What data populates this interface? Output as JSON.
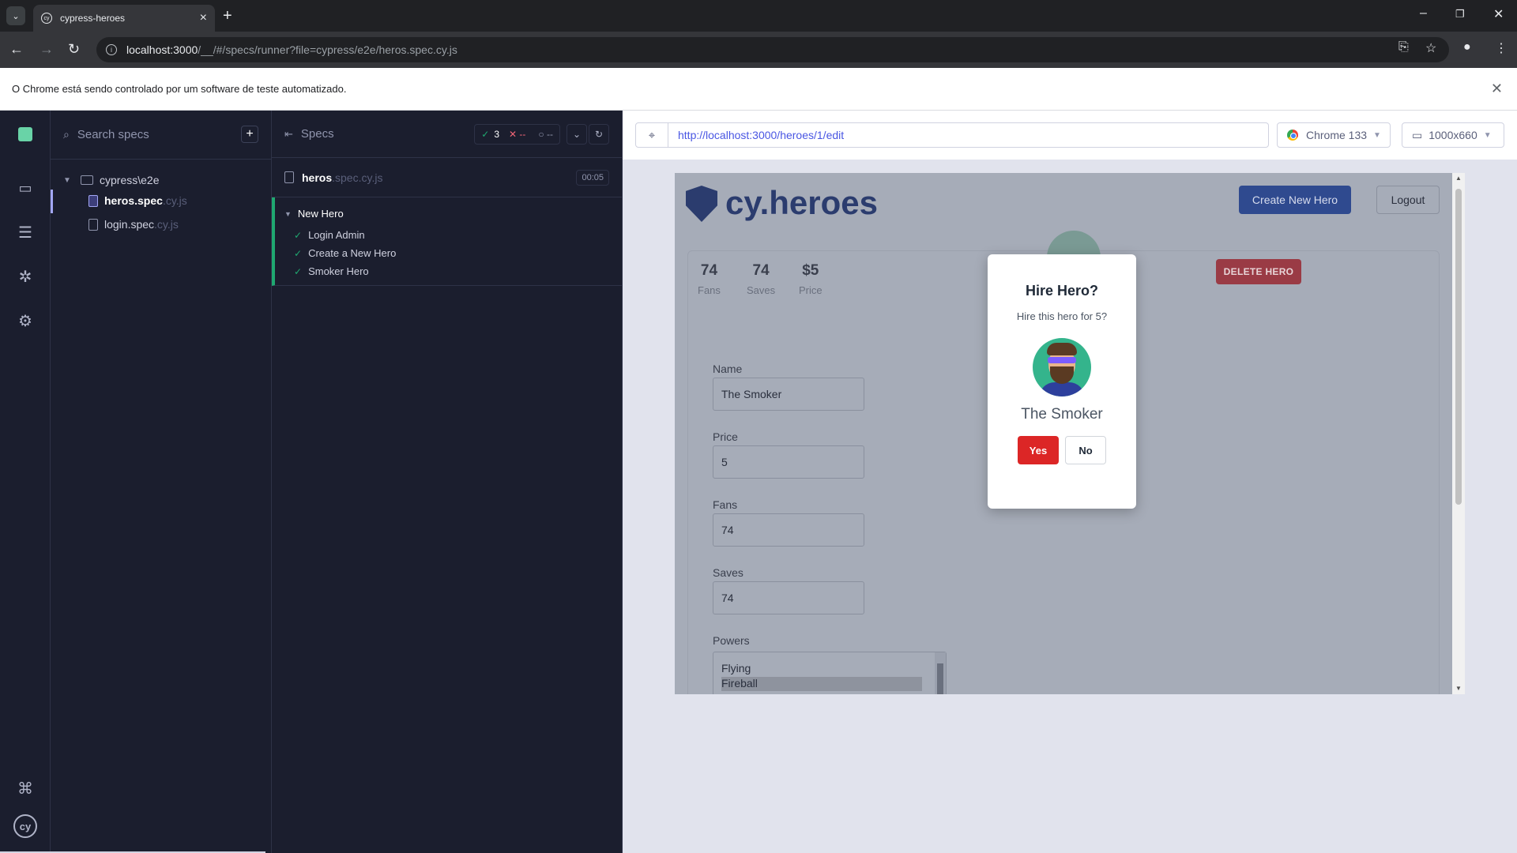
{
  "browser": {
    "tab_title": "cypress-heroes",
    "address_host": "localhost:3000",
    "address_path": "/__/#/specs/runner?file=cypress/e2e/heros.spec.cy.js",
    "infobar_text": "O Chrome está sendo controlado por um software de teste automatizado."
  },
  "specs_panel": {
    "search_placeholder": "Search specs",
    "folder": "cypress\\e2e",
    "files": [
      {
        "name": "heros.spec",
        "ext": ".cy.js"
      },
      {
        "name": "login.spec",
        "ext": ".cy.js"
      }
    ]
  },
  "reporter": {
    "title": "Specs",
    "passed": "3",
    "failed": "--",
    "pending": "--",
    "spec_name": "heros",
    "spec_ext": ".spec.cy.js",
    "duration": "00:05",
    "suite": "New Hero",
    "tests": [
      "Login Admin",
      "Create a New Hero",
      "Smoker Hero"
    ]
  },
  "aut": {
    "url": "http://localhost:3000/heroes/1/edit",
    "browser": "Chrome 133",
    "viewport": "1000x660"
  },
  "hero_app": {
    "brand": "cy.heroes",
    "create_button": "Create New Hero",
    "logout_button": "Logout",
    "stats": [
      {
        "value": "74",
        "label": "Fans"
      },
      {
        "value": "74",
        "label": "Saves"
      },
      {
        "value": "$5",
        "label": "Price"
      }
    ],
    "delete_button": "DELETE HERO",
    "fields": [
      {
        "label": "Name",
        "value": "The Smoker"
      },
      {
        "label": "Price",
        "value": "5"
      },
      {
        "label": "Fans",
        "value": "74"
      },
      {
        "label": "Saves",
        "value": "74"
      }
    ],
    "powers_label": "Powers",
    "powers": [
      "Flying",
      "Fireball"
    ],
    "selected_power": "Fireball"
  },
  "modal": {
    "title": "Hire Hero?",
    "message": "Hire this hero for 5?",
    "hero_name": "The Smoker",
    "yes": "Yes",
    "no": "No"
  }
}
